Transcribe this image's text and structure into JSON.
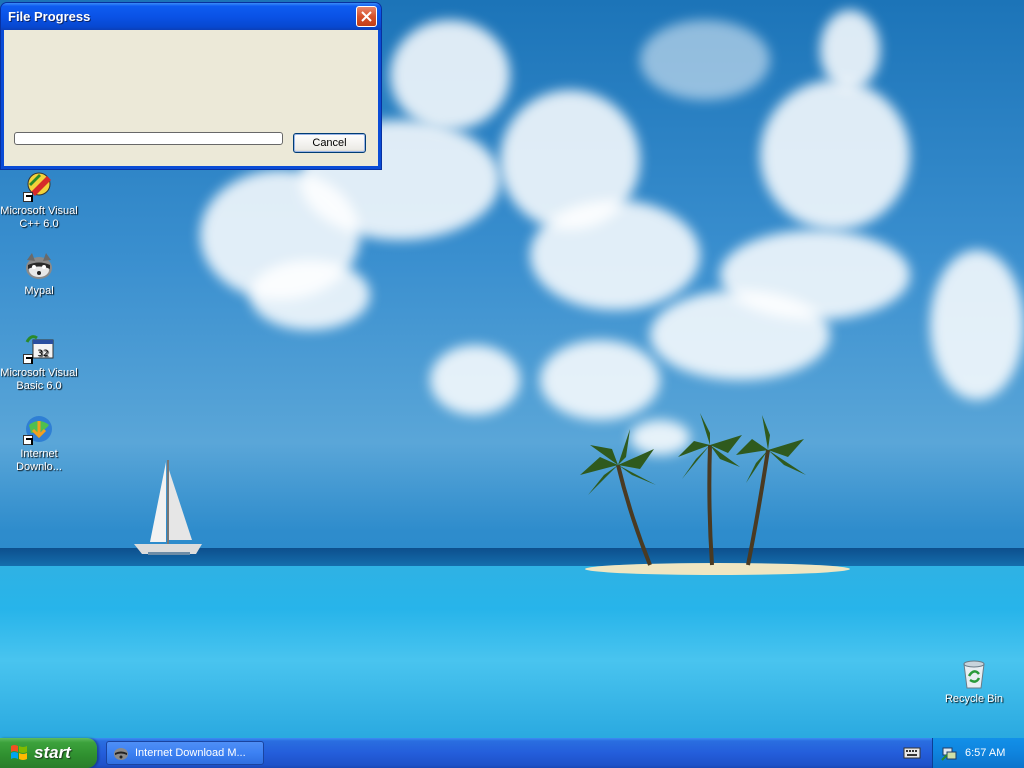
{
  "dialog": {
    "title": "File Progress",
    "cancel_label": "Cancel",
    "progress": 0
  },
  "desktop_icons": [
    {
      "label": "Microsoft Visual C++ 6.0",
      "icon": "visual-cpp-icon"
    },
    {
      "label": "Mypal",
      "icon": "mypal-icon"
    },
    {
      "label": "Microsoft Visual Basic 6.0",
      "icon": "visual-basic-icon"
    },
    {
      "label": "Internet Downlo...",
      "icon": "internet-download-manager-icon"
    },
    {
      "label": "Recycle Bin",
      "icon": "recycle-bin-icon"
    }
  ],
  "taskbar": {
    "start_label": "start",
    "task_label": "Internet Download M...",
    "clock": "6:57 AM"
  },
  "colors": {
    "titlebar": "#0a52e6",
    "taskbar": "#245edb",
    "start_button": "#3ca23c",
    "dialog_body": "#ece9d8"
  }
}
